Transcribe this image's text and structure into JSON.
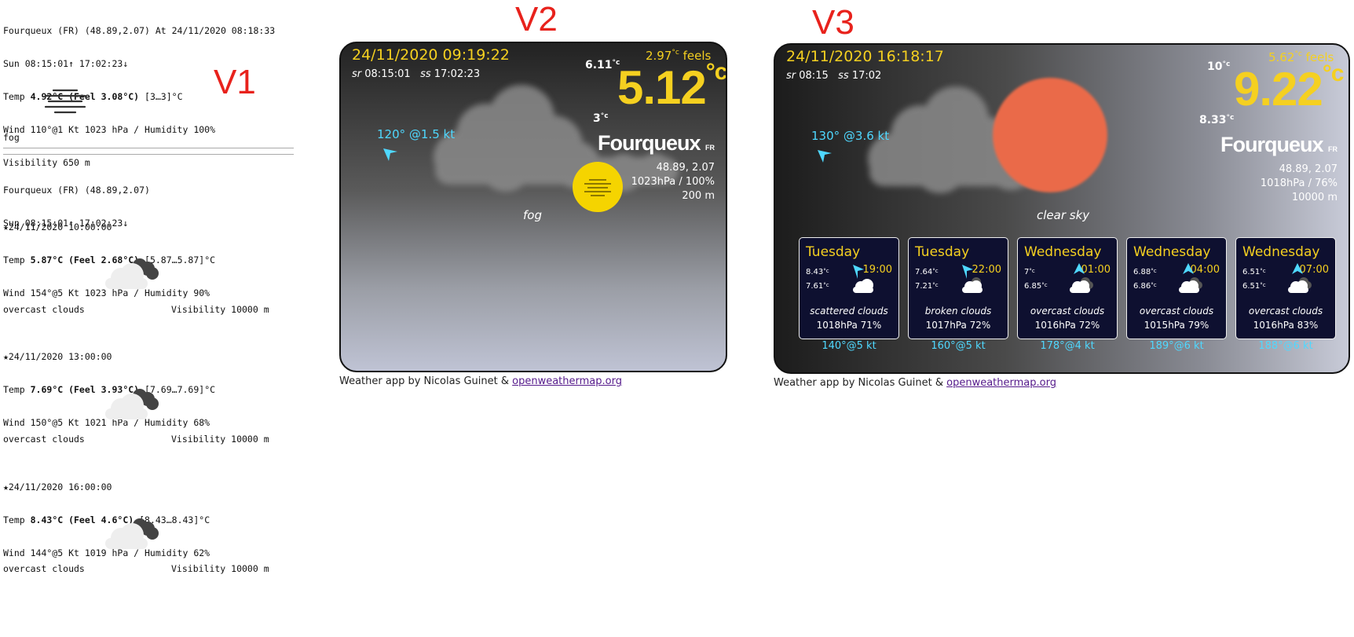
{
  "v1": {
    "label": "V1",
    "header": {
      "line1": "Fourqueux (FR) (48.89,2.07) At 24/11/2020 08:18:33",
      "line2": "Sun 08:15:01↑ 17:02:23↓",
      "temp_prefix": "Temp ",
      "temp_bold": "4.92°C (Feel 3.08°C)",
      "temp_range": " [3…3]°C",
      "wind": "Wind 110°@1 Kt 1023 hPa / Humidity 100%",
      "visibility": "Visibility 650 m",
      "icon": "fog-icon",
      "desc": "fog"
    },
    "forecast_header": {
      "line1": "Fourqueux (FR) (48.89,2.07)",
      "line2": "Sun 08:15:01↑ 17:02:23↓"
    },
    "entries": [
      {
        "time": "★24/11/2020 10:00:00",
        "temp_bold": "5.87°C (Feel 2.68°C)",
        "range": " [5.87…5.87]°C",
        "wind": "Wind 154°@5 Kt 1023 hPa / Humidity 90%",
        "desc": "overcast clouds",
        "visibility": "Visibility 10000 m"
      },
      {
        "time": "★24/11/2020 13:00:00",
        "temp_bold": "7.69°C (Feel 3.93°C)",
        "range": " [7.69…7.69]°C",
        "wind": "Wind 150°@5 Kt 1021 hPa / Humidity 68%",
        "desc": "overcast clouds",
        "visibility": "Visibility 10000 m"
      },
      {
        "time": "★24/11/2020 16:00:00",
        "temp_bold": "8.43°C (Feel 4.6°C)",
        "range": " [8.43…8.43]°C",
        "wind": "Wind 144°@5 Kt 1019 hPa / Humidity 62%",
        "desc": "overcast clouds",
        "visibility": "Visibility 10000 m"
      }
    ],
    "temp_prefix": "Temp "
  },
  "v2": {
    "label": "V2",
    "date": "24/11/2020 09:19:22",
    "sr_label": "sr",
    "sr": "08:15:01",
    "ss_label": "ss",
    "ss": "17:02:23",
    "max": "6.11",
    "min": "3",
    "feels_val": "2.97",
    "feels_label": "feels",
    "temp": "5.12",
    "unit": "°c",
    "city": "Fourqueux",
    "country": "FR",
    "coords": "48.89, 2.07",
    "pressure_humidity": "1023hPa / 100%",
    "visibility": "200 m",
    "wind": "120° @1.5 kt",
    "desc": "fog",
    "footer_text": "Weather app by Nicolas Guinet & ",
    "footer_link": "openweathermap.org"
  },
  "v3": {
    "label": "V3",
    "date": "24/11/2020 16:18:17",
    "sr_label": "sr",
    "sr": "08:15",
    "ss_label": "ss",
    "ss": "17:02",
    "max": "10",
    "min": "8.33",
    "feels_val": "5.62",
    "feels_label": "feels",
    "temp": "9.22",
    "unit": "°c",
    "city": "Fourqueux",
    "country": "FR",
    "coords": "48.89, 2.07",
    "pressure_humidity": "1018hPa / 76%",
    "visibility": "10000 m",
    "wind": "130° @3.6 kt",
    "desc": "clear sky",
    "forecast": [
      {
        "day": "Tuesday",
        "hour": "19:00",
        "t1": "8.43",
        "t2": "7.61",
        "desc": "scattered clouds",
        "press": "1018hPa   71%",
        "wind": "140°@5 kt"
      },
      {
        "day": "Tuesday",
        "hour": "22:00",
        "t1": "7.64",
        "t2": "7.21",
        "desc": "broken clouds",
        "press": "1017hPa   72%",
        "wind": "160°@5 kt"
      },
      {
        "day": "Wednesday",
        "hour": "01:00",
        "t1": "7",
        "t2": "6.85",
        "desc": "overcast clouds",
        "press": "1016hPa   72%",
        "wind": "178°@4 kt"
      },
      {
        "day": "Wednesday",
        "hour": "04:00",
        "t1": "6.88",
        "t2": "6.86",
        "desc": "overcast clouds",
        "press": "1015hPa   79%",
        "wind": "189°@6 kt"
      },
      {
        "day": "Wednesday",
        "hour": "07:00",
        "t1": "6.51",
        "t2": "6.51",
        "desc": "overcast clouds",
        "press": "1016hPa   83%",
        "wind": "188°@6 kt"
      }
    ],
    "footer_text": "Weather app by Nicolas Guinet & ",
    "footer_link": "openweathermap.org"
  },
  "colors": {
    "accent_yellow": "#f5d020",
    "wind_cyan": "#4fd8ff",
    "label_red": "#e8221c",
    "sun_orange": "#ea6a4a"
  }
}
